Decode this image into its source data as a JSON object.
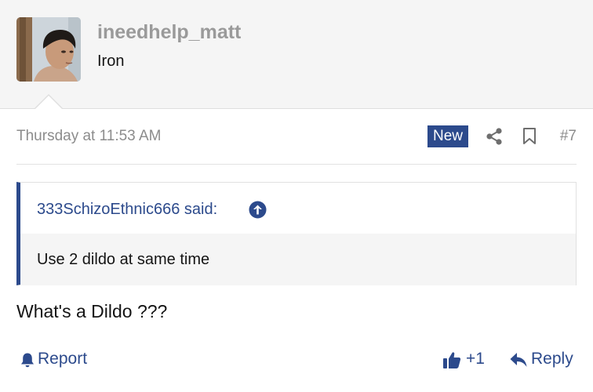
{
  "user": {
    "username": "ineedhelp_matt",
    "title": "Iron"
  },
  "post": {
    "date": "Thursday at 11:53 AM",
    "new_badge": "New",
    "number": "#7",
    "message": "What's a Dildo ???"
  },
  "quote": {
    "author": "333SchizoEthnic666 said:",
    "text": "Use 2 dildo at same time"
  },
  "actions": {
    "report": "Report",
    "like_count": "+1",
    "reply": "Reply"
  },
  "icons": {
    "share": "share-icon",
    "bookmark": "bookmark-icon",
    "quote_jump": "arrow-up-circle-icon",
    "report": "bell-icon",
    "like": "thumbs-up-icon",
    "reply": "reply-arrow-icon"
  },
  "colors": {
    "accent": "#2c4a8c",
    "muted_text": "#8c8c8c",
    "username": "#9a9a9a",
    "user_block_bg": "#f5f5f5"
  }
}
